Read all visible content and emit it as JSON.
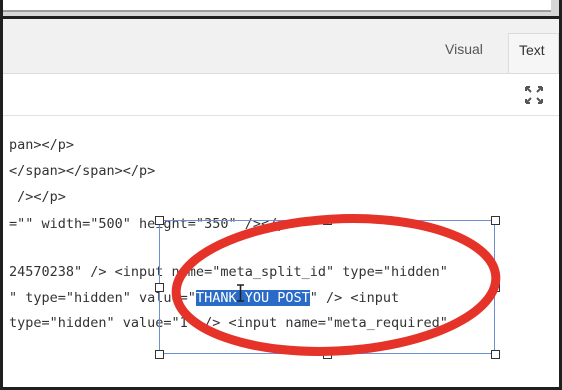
{
  "tabs": {
    "visual": "Visual",
    "text": "Text"
  },
  "icons": {
    "expand": "expand-icon"
  },
  "code_lines": [
    "pan></p>",
    "</span></span></p>",
    " /></p>",
    "=\"\" width=\"500\" height=\"350\" /></p>",
    "24570238\" /> <input name=\"meta_split_id\" type=\"hidden\"",
    "\" type=\"hidden\" value=\"",
    "\" /> <input",
    "type=\"hidden\" value=\"1\" /> <input name=\"meta_required\""
  ],
  "highlighted_text": "THANK YOU POST",
  "colors": {
    "selection": "#2a6bc8",
    "annotation": "#e53329"
  }
}
